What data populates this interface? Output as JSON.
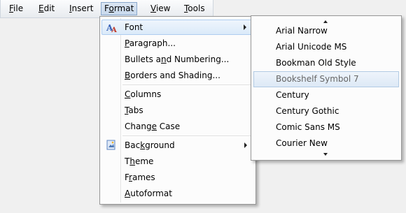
{
  "menubar": {
    "items": [
      {
        "label": "File",
        "underline": "F"
      },
      {
        "label": "Edit",
        "underline": "E"
      },
      {
        "label": "Insert",
        "underline": "I"
      },
      {
        "label": "Format",
        "underline": "o"
      },
      {
        "label": "View",
        "underline": "V"
      },
      {
        "label": "Tools",
        "underline": "T"
      }
    ],
    "active": "Format"
  },
  "format_menu": {
    "items": [
      {
        "label": "Font",
        "underline": "",
        "submenu": true,
        "icon": "font-icon",
        "highlighted": true
      },
      {
        "label": "Paragraph...",
        "underline": "P"
      },
      {
        "label": "Bullets and Numbering...",
        "underline": "n"
      },
      {
        "label": "Borders and Shading...",
        "underline": "B"
      },
      {
        "label": "Columns",
        "underline": "C"
      },
      {
        "label": "Tabs",
        "underline": "T"
      },
      {
        "label": "Change Case",
        "underline": "e"
      },
      {
        "label": "Background",
        "underline": "k",
        "submenu": true,
        "icon": "background-icon"
      },
      {
        "label": "Theme",
        "underline": "h"
      },
      {
        "label": "Frames",
        "underline": "r"
      },
      {
        "label": "Autoformat",
        "underline": "A"
      }
    ]
  },
  "font_menu": {
    "items": [
      "Arial Narrow",
      "Arial Unicode MS",
      "Bookman Old Style",
      "Bookshelf Symbol 7",
      "Century",
      "Century Gothic",
      "Comic Sans MS",
      "Courier New"
    ],
    "selected": "Bookshelf Symbol 7",
    "scroll_up_icon": "scroll-up-icon",
    "scroll_down_icon": "scroll-down-icon"
  },
  "colors": {
    "highlight": "#dbeaf9",
    "highlight_border": "#aecdf0",
    "menu_background": "#fcfcfc",
    "desktop": "#f0f0f0"
  }
}
